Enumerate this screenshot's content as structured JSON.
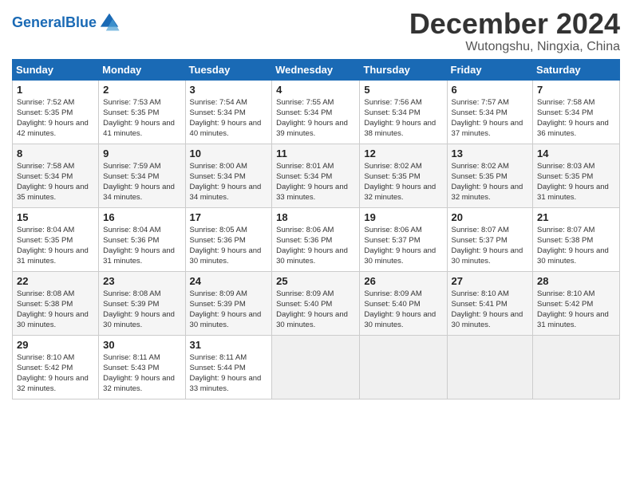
{
  "header": {
    "logo_general": "General",
    "logo_blue": "Blue",
    "month": "December 2024",
    "location": "Wutongshu, Ningxia, China"
  },
  "weekdays": [
    "Sunday",
    "Monday",
    "Tuesday",
    "Wednesday",
    "Thursday",
    "Friday",
    "Saturday"
  ],
  "weeks": [
    [
      {
        "day": "1",
        "sunrise": "Sunrise: 7:52 AM",
        "sunset": "Sunset: 5:35 PM",
        "daylight": "Daylight: 9 hours and 42 minutes."
      },
      {
        "day": "2",
        "sunrise": "Sunrise: 7:53 AM",
        "sunset": "Sunset: 5:35 PM",
        "daylight": "Daylight: 9 hours and 41 minutes."
      },
      {
        "day": "3",
        "sunrise": "Sunrise: 7:54 AM",
        "sunset": "Sunset: 5:34 PM",
        "daylight": "Daylight: 9 hours and 40 minutes."
      },
      {
        "day": "4",
        "sunrise": "Sunrise: 7:55 AM",
        "sunset": "Sunset: 5:34 PM",
        "daylight": "Daylight: 9 hours and 39 minutes."
      },
      {
        "day": "5",
        "sunrise": "Sunrise: 7:56 AM",
        "sunset": "Sunset: 5:34 PM",
        "daylight": "Daylight: 9 hours and 38 minutes."
      },
      {
        "day": "6",
        "sunrise": "Sunrise: 7:57 AM",
        "sunset": "Sunset: 5:34 PM",
        "daylight": "Daylight: 9 hours and 37 minutes."
      },
      {
        "day": "7",
        "sunrise": "Sunrise: 7:58 AM",
        "sunset": "Sunset: 5:34 PM",
        "daylight": "Daylight: 9 hours and 36 minutes."
      }
    ],
    [
      {
        "day": "8",
        "sunrise": "Sunrise: 7:58 AM",
        "sunset": "Sunset: 5:34 PM",
        "daylight": "Daylight: 9 hours and 35 minutes."
      },
      {
        "day": "9",
        "sunrise": "Sunrise: 7:59 AM",
        "sunset": "Sunset: 5:34 PM",
        "daylight": "Daylight: 9 hours and 34 minutes."
      },
      {
        "day": "10",
        "sunrise": "Sunrise: 8:00 AM",
        "sunset": "Sunset: 5:34 PM",
        "daylight": "Daylight: 9 hours and 34 minutes."
      },
      {
        "day": "11",
        "sunrise": "Sunrise: 8:01 AM",
        "sunset": "Sunset: 5:34 PM",
        "daylight": "Daylight: 9 hours and 33 minutes."
      },
      {
        "day": "12",
        "sunrise": "Sunrise: 8:02 AM",
        "sunset": "Sunset: 5:35 PM",
        "daylight": "Daylight: 9 hours and 32 minutes."
      },
      {
        "day": "13",
        "sunrise": "Sunrise: 8:02 AM",
        "sunset": "Sunset: 5:35 PM",
        "daylight": "Daylight: 9 hours and 32 minutes."
      },
      {
        "day": "14",
        "sunrise": "Sunrise: 8:03 AM",
        "sunset": "Sunset: 5:35 PM",
        "daylight": "Daylight: 9 hours and 31 minutes."
      }
    ],
    [
      {
        "day": "15",
        "sunrise": "Sunrise: 8:04 AM",
        "sunset": "Sunset: 5:35 PM",
        "daylight": "Daylight: 9 hours and 31 minutes."
      },
      {
        "day": "16",
        "sunrise": "Sunrise: 8:04 AM",
        "sunset": "Sunset: 5:36 PM",
        "daylight": "Daylight: 9 hours and 31 minutes."
      },
      {
        "day": "17",
        "sunrise": "Sunrise: 8:05 AM",
        "sunset": "Sunset: 5:36 PM",
        "daylight": "Daylight: 9 hours and 30 minutes."
      },
      {
        "day": "18",
        "sunrise": "Sunrise: 8:06 AM",
        "sunset": "Sunset: 5:36 PM",
        "daylight": "Daylight: 9 hours and 30 minutes."
      },
      {
        "day": "19",
        "sunrise": "Sunrise: 8:06 AM",
        "sunset": "Sunset: 5:37 PM",
        "daylight": "Daylight: 9 hours and 30 minutes."
      },
      {
        "day": "20",
        "sunrise": "Sunrise: 8:07 AM",
        "sunset": "Sunset: 5:37 PM",
        "daylight": "Daylight: 9 hours and 30 minutes."
      },
      {
        "day": "21",
        "sunrise": "Sunrise: 8:07 AM",
        "sunset": "Sunset: 5:38 PM",
        "daylight": "Daylight: 9 hours and 30 minutes."
      }
    ],
    [
      {
        "day": "22",
        "sunrise": "Sunrise: 8:08 AM",
        "sunset": "Sunset: 5:38 PM",
        "daylight": "Daylight: 9 hours and 30 minutes."
      },
      {
        "day": "23",
        "sunrise": "Sunrise: 8:08 AM",
        "sunset": "Sunset: 5:39 PM",
        "daylight": "Daylight: 9 hours and 30 minutes."
      },
      {
        "day": "24",
        "sunrise": "Sunrise: 8:09 AM",
        "sunset": "Sunset: 5:39 PM",
        "daylight": "Daylight: 9 hours and 30 minutes."
      },
      {
        "day": "25",
        "sunrise": "Sunrise: 8:09 AM",
        "sunset": "Sunset: 5:40 PM",
        "daylight": "Daylight: 9 hours and 30 minutes."
      },
      {
        "day": "26",
        "sunrise": "Sunrise: 8:09 AM",
        "sunset": "Sunset: 5:40 PM",
        "daylight": "Daylight: 9 hours and 30 minutes."
      },
      {
        "day": "27",
        "sunrise": "Sunrise: 8:10 AM",
        "sunset": "Sunset: 5:41 PM",
        "daylight": "Daylight: 9 hours and 30 minutes."
      },
      {
        "day": "28",
        "sunrise": "Sunrise: 8:10 AM",
        "sunset": "Sunset: 5:42 PM",
        "daylight": "Daylight: 9 hours and 31 minutes."
      }
    ],
    [
      {
        "day": "29",
        "sunrise": "Sunrise: 8:10 AM",
        "sunset": "Sunset: 5:42 PM",
        "daylight": "Daylight: 9 hours and 32 minutes."
      },
      {
        "day": "30",
        "sunrise": "Sunrise: 8:11 AM",
        "sunset": "Sunset: 5:43 PM",
        "daylight": "Daylight: 9 hours and 32 minutes."
      },
      {
        "day": "31",
        "sunrise": "Sunrise: 8:11 AM",
        "sunset": "Sunset: 5:44 PM",
        "daylight": "Daylight: 9 hours and 33 minutes."
      },
      null,
      null,
      null,
      null
    ]
  ]
}
